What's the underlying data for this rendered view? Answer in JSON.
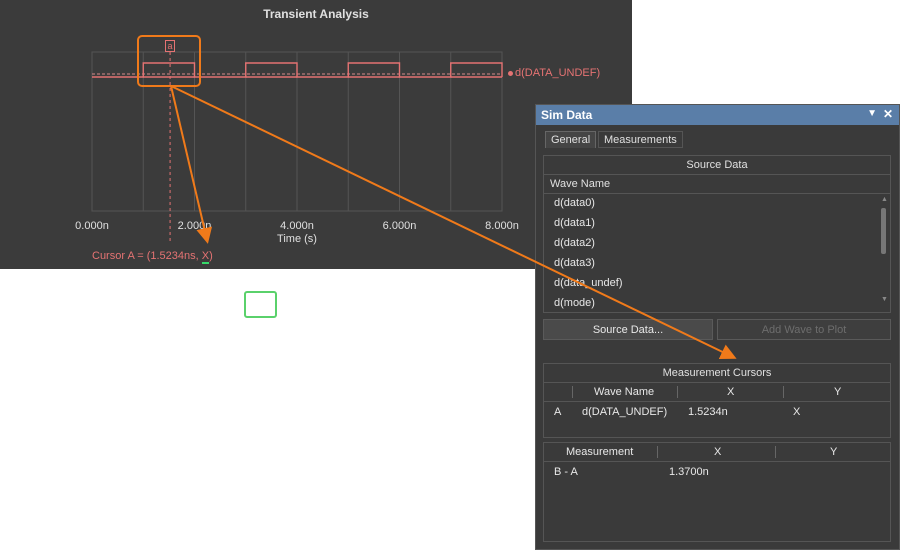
{
  "chart": {
    "title": "Transient Analysis",
    "xlabel": "Time (s)",
    "wave_label": "d(DATA_UNDEF)",
    "cursor_flag": "a",
    "cursor_readout_prefix": "Cursor A = (1.5234ns, ",
    "cursor_readout_x": "X",
    "cursor_readout_suffix": ")",
    "colors": {
      "wave": "#e57373",
      "callout": "#f07a1a",
      "highlight": "#5ad16b"
    }
  },
  "chart_data": {
    "type": "line",
    "title": "Transient Analysis",
    "xlabel": "Time (s)",
    "ylabel": "",
    "x_tick_labels": [
      "0.000n",
      "2.000n",
      "4.000n",
      "6.000n",
      "8.000n"
    ],
    "x_ticks_ns": [
      0,
      2,
      4,
      6,
      8
    ],
    "xlim_ns": [
      0,
      8
    ],
    "grid": true,
    "legend": "right",
    "series": [
      {
        "name": "d(DATA_UNDEF)",
        "pulse_start_ns": [
          1.0,
          3.0,
          5.0,
          7.0
        ],
        "pulse_width_ns": 1.0,
        "low": 0,
        "high": 1
      }
    ],
    "cursor": {
      "name": "A",
      "x_ns": 1.5234
    }
  },
  "panel": {
    "title": "Sim Data",
    "menu_icon": "dropdown-arrow-icon",
    "close_icon": "close-icon",
    "tabs": [
      "General",
      "Measurements"
    ],
    "source_data": {
      "header": "Source Data",
      "column": "Wave Name",
      "items": [
        "d(data0)",
        "d(data1)",
        "d(data2)",
        "d(data3)",
        "d(data_undef)",
        "d(mode)"
      ]
    },
    "buttons": {
      "source_data": "Source Data...",
      "add_wave": "Add Wave to Plot"
    },
    "measurement_cursors": {
      "header": "Measurement Cursors",
      "columns": [
        "Wave Name",
        "X",
        "Y"
      ],
      "row": {
        "cursor": "A",
        "wave": "d(DATA_UNDEF)",
        "x": "1.5234n",
        "y": "X"
      }
    },
    "measurements": {
      "columns": [
        "Measurement",
        "X",
        "Y"
      ],
      "row": {
        "name": "B - A",
        "x": "1.3700n",
        "y": ""
      }
    }
  }
}
